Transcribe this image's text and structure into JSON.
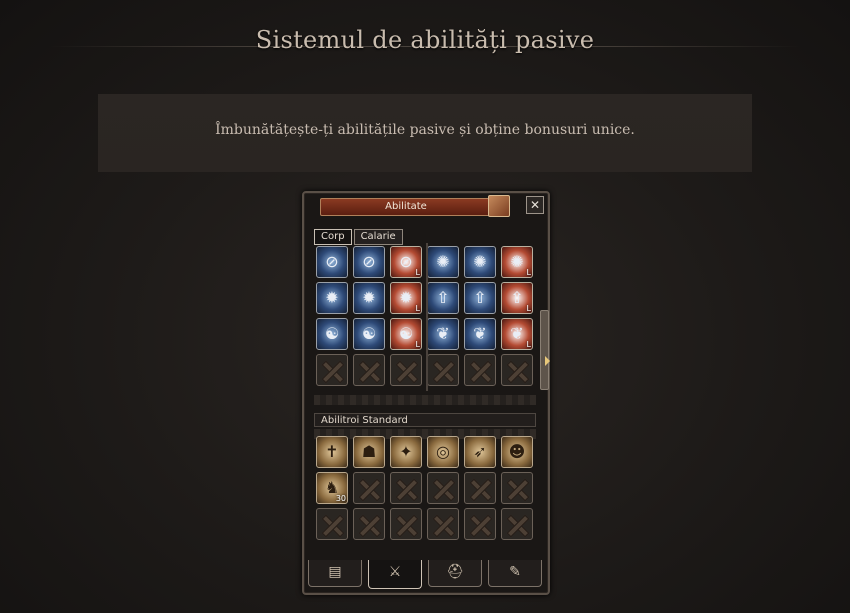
{
  "page": {
    "title": "Sistemul de abilități pasive",
    "subtitle": "Îmbunătățește-ți abilitățile pasive și obține bonusuri unice."
  },
  "window": {
    "title": "Abilitate",
    "close_label": "✕",
    "tabs": [
      {
        "label": "Corp",
        "active": true
      },
      {
        "label": "Calarie",
        "active": false
      }
    ],
    "passive_rows": [
      [
        {
          "type": "blue",
          "icon": "stripes-icon",
          "glyph": "⊘"
        },
        {
          "type": "blue",
          "icon": "stripes-icon",
          "glyph": "⊘"
        },
        {
          "type": "red",
          "icon": "stripes-icon",
          "glyph": "⊘",
          "badge": "L"
        },
        {
          "type": "blue",
          "icon": "swirl-icon",
          "glyph": "✺"
        },
        {
          "type": "blue",
          "icon": "swirl-icon",
          "glyph": "✺"
        },
        {
          "type": "red",
          "icon": "swirl-icon",
          "glyph": "✺",
          "badge": "L"
        }
      ],
      [
        {
          "type": "blue",
          "icon": "starburst-icon",
          "glyph": "✹"
        },
        {
          "type": "blue",
          "icon": "starburst-icon",
          "glyph": "✹"
        },
        {
          "type": "red",
          "icon": "starburst-icon",
          "glyph": "✹",
          "badge": "L"
        },
        {
          "type": "blue",
          "icon": "tree-icon",
          "glyph": "⇧"
        },
        {
          "type": "blue",
          "icon": "tree-icon",
          "glyph": "⇧"
        },
        {
          "type": "red",
          "icon": "tree-icon",
          "glyph": "⇧",
          "badge": "L"
        }
      ],
      [
        {
          "type": "blue",
          "icon": "yin-yang-icon",
          "glyph": "☯"
        },
        {
          "type": "blue",
          "icon": "yin-yang-icon",
          "glyph": "☯"
        },
        {
          "type": "red",
          "icon": "yin-yang-icon",
          "glyph": "☯",
          "badge": "L"
        },
        {
          "type": "blue",
          "icon": "roots-icon",
          "glyph": "❦"
        },
        {
          "type": "blue",
          "icon": "roots-icon",
          "glyph": "❦"
        },
        {
          "type": "red",
          "icon": "roots-icon",
          "glyph": "❦",
          "badge": "L"
        }
      ],
      [
        {
          "type": "empty"
        },
        {
          "type": "empty"
        },
        {
          "type": "empty"
        },
        {
          "type": "empty"
        },
        {
          "type": "empty"
        },
        {
          "type": "empty"
        }
      ]
    ],
    "standard_label": "Abilitroi Standard",
    "standard_rows": [
      [
        {
          "type": "gold",
          "icon": "cross-icon",
          "glyph": "✝"
        },
        {
          "type": "gold",
          "icon": "hood-icon",
          "glyph": "☗"
        },
        {
          "type": "gold",
          "icon": "spark-icon",
          "glyph": "✦"
        },
        {
          "type": "gold",
          "icon": "target-icon",
          "glyph": "◎"
        },
        {
          "type": "gold",
          "icon": "arrow-target-icon",
          "glyph": "➶"
        },
        {
          "type": "gold",
          "icon": "head-icon",
          "glyph": "☻"
        }
      ],
      [
        {
          "type": "gold",
          "icon": "horse-icon",
          "glyph": "♞",
          "badge": "30"
        },
        {
          "type": "empty"
        },
        {
          "type": "empty"
        },
        {
          "type": "empty"
        },
        {
          "type": "empty"
        },
        {
          "type": "empty"
        }
      ],
      [
        {
          "type": "empty"
        },
        {
          "type": "empty"
        },
        {
          "type": "empty"
        },
        {
          "type": "empty"
        },
        {
          "type": "empty"
        },
        {
          "type": "empty"
        }
      ]
    ],
    "bottom_tabs": [
      {
        "icon": "character-card-icon",
        "glyph": "▤",
        "active": false
      },
      {
        "icon": "sword-icon",
        "glyph": "⚔",
        "active": true
      },
      {
        "icon": "helmet-icon",
        "glyph": "⛑",
        "active": false
      },
      {
        "icon": "scroll-icon",
        "glyph": "✎",
        "active": false
      }
    ]
  }
}
